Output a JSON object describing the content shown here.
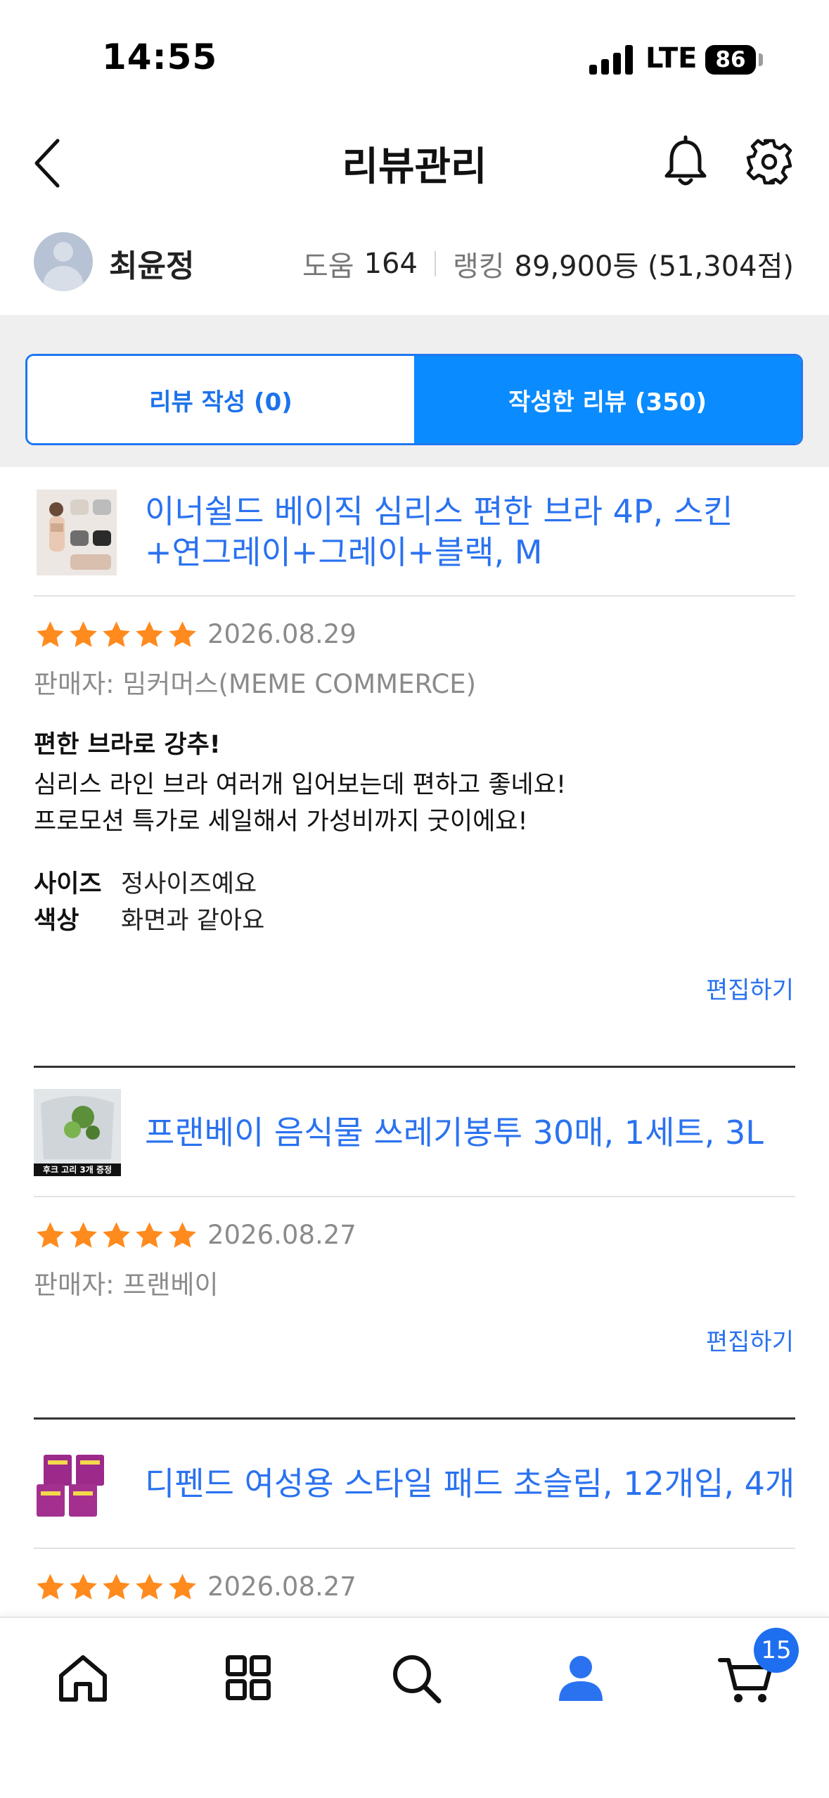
{
  "status_bar": {
    "time": "14:55",
    "network": "LTE",
    "battery": "86"
  },
  "header": {
    "title": "리뷰관리"
  },
  "profile": {
    "name": "최윤정",
    "help_label": "도움",
    "help_count": "164",
    "ranking_label": "랭킹",
    "ranking_value": "89,900등 (51,304점)"
  },
  "tabs": [
    {
      "label": "리뷰 작성 (0)",
      "active": false
    },
    {
      "label": "작성한 리뷰 (350)",
      "active": true
    }
  ],
  "colors": {
    "accent": "#0a8bff",
    "link": "#2a72f0",
    "star": "#ff8a1e"
  },
  "reviews": [
    {
      "product_title": [
        "이너쉴드 베이직 심리스 편한 브라 4P, 스킨",
        "+연그레이+그레이+블랙, M"
      ],
      "rating": 5,
      "date": "2026.08.29",
      "seller": "판매자: 밈커머스(MEME COMMERCE)",
      "headline": "편한 브라로 강추!",
      "body": [
        "심리스 라인 브라 여러개 입어보는데 편하고 좋네요!",
        "프로모션 특가로 세일해서 가성비까지 굿이에요!"
      ],
      "attributes": [
        {
          "name": "사이즈",
          "value": "정사이즈예요"
        },
        {
          "name": "색상",
          "value": "화면과 같아요"
        }
      ],
      "edit_label": "편집하기"
    },
    {
      "product_title": [
        "프랜베이 음식물 쓰레기봉투 30매, 1세트, 3L"
      ],
      "thumb_caption": "후크 고리 3개 증정",
      "rating": 5,
      "date": "2026.08.27",
      "seller": "판매자: 프랜베이",
      "edit_label": "편집하기"
    },
    {
      "product_title": [
        "디펜드 여성용 스타일 패드 초슬림, 12개입, 4개"
      ],
      "rating": 5,
      "date": "2026.08.27"
    }
  ],
  "bottom_nav": {
    "items": [
      "home-icon",
      "categories-icon",
      "search-icon",
      "my-page-icon",
      "cart-icon"
    ],
    "cart_count": "15"
  }
}
